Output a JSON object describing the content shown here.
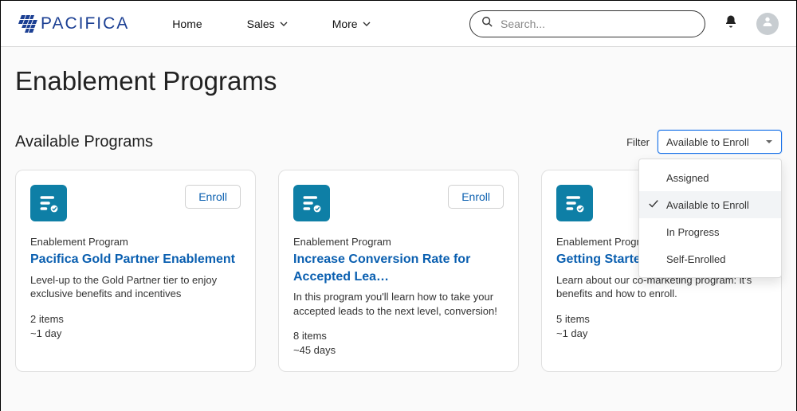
{
  "brand": {
    "name": "PACIFICA"
  },
  "nav": {
    "home": "Home",
    "sales": "Sales",
    "more": "More"
  },
  "search": {
    "placeholder": "Search..."
  },
  "page_title": "Enablement Programs",
  "section_title": "Available Programs",
  "filter": {
    "label": "Filter",
    "selected": "Available to Enroll",
    "options": [
      {
        "label": "Assigned",
        "selected": false
      },
      {
        "label": "Available to Enroll",
        "selected": true
      },
      {
        "label": "In Progress",
        "selected": false
      },
      {
        "label": "Self-Enrolled",
        "selected": false
      }
    ]
  },
  "cards": [
    {
      "category": "Enablement Program",
      "title": "Pacifica Gold Partner Enablement",
      "desc": "Level-up to the Gold Partner tier to enjoy exclusive benefits and incentives",
      "items": "2 items",
      "duration": "~1 day",
      "enroll": "Enroll"
    },
    {
      "category": "Enablement Program",
      "title": "Increase Conversion Rate for Accepted Lea…",
      "desc": "In this program you'll learn how to take your accepted leads to the next level, conversion!",
      "items": "8 items",
      "duration": "~45 days",
      "enroll": "Enroll"
    },
    {
      "category": "Enablement Program",
      "title": "Getting Started with MDFs",
      "desc": "Learn about our co-marketing program: it's benefits and how to enroll.",
      "items": "5 items",
      "duration": "~1 day",
      "enroll": ""
    }
  ]
}
